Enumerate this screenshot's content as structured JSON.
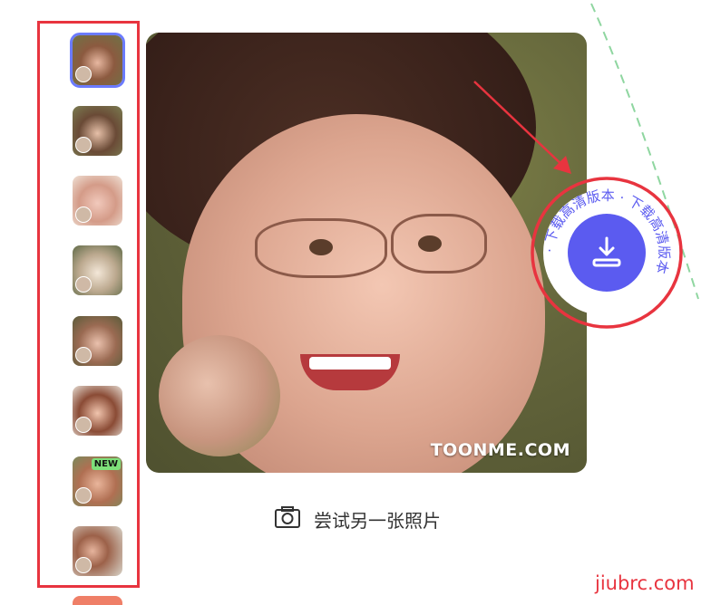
{
  "sidebar": {
    "thumbnails": [
      {
        "label": "style-1",
        "active": true,
        "badge": ""
      },
      {
        "label": "style-2",
        "active": false,
        "badge": ""
      },
      {
        "label": "style-3",
        "active": false,
        "badge": ""
      },
      {
        "label": "style-4",
        "active": false,
        "badge": ""
      },
      {
        "label": "style-5",
        "active": false,
        "badge": ""
      },
      {
        "label": "style-6",
        "active": false,
        "badge": ""
      },
      {
        "label": "style-7",
        "active": false,
        "badge": "NEW"
      },
      {
        "label": "style-8",
        "active": false,
        "badge": ""
      }
    ]
  },
  "preview": {
    "watermark": "TOONME.COM"
  },
  "actions": {
    "try_another_label": "尝试另一张照片",
    "download_ring_text": "· 下载高清版本 · 下载高清版本 "
  },
  "footer": {
    "site": "jiubrc.com"
  },
  "colors": {
    "highlight_red": "#e8343f",
    "accent_blue": "#5b5bf0",
    "active_border": "#6b7bff",
    "dashed_green": "#8fd6a0"
  }
}
